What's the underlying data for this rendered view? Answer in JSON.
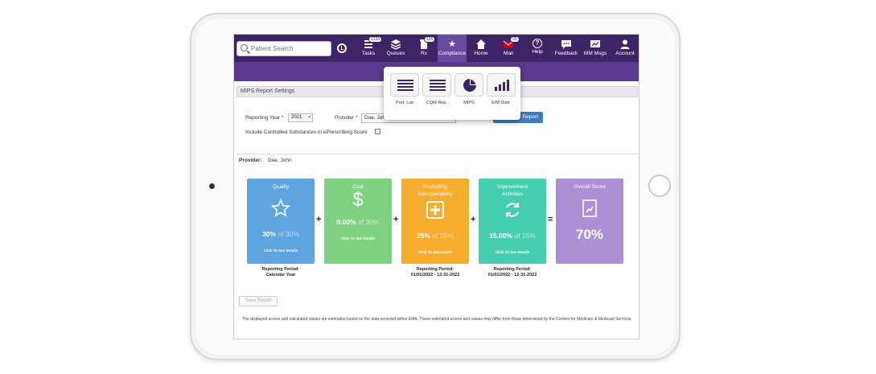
{
  "search": {
    "placeholder": "Patient Search"
  },
  "nav": [
    {
      "id": "tasks",
      "label": "Tasks",
      "icon": "tasks-icon",
      "badge": "1235"
    },
    {
      "id": "queues",
      "label": "Queues",
      "icon": "queues-icon"
    },
    {
      "id": "rx",
      "label": "Rx",
      "icon": "rx-icon",
      "badge": "135"
    },
    {
      "id": "compliance",
      "label": "Compliance",
      "icon": "star-icon"
    },
    {
      "id": "home",
      "label": "Home",
      "icon": "home-icon"
    },
    {
      "id": "mail",
      "label": "Mail",
      "icon": "mail-icon",
      "badge": "35"
    },
    {
      "id": "help",
      "label": "Help",
      "icon": "help-icon"
    },
    {
      "id": "feedback",
      "label": "Feedback",
      "icon": "feedback-icon"
    },
    {
      "id": "mm-msgs",
      "label": "MM Msgs",
      "icon": "messages-icon"
    },
    {
      "id": "account",
      "label": "Account",
      "icon": "account-icon"
    }
  ],
  "dropdown": {
    "items": [
      {
        "label": "Port. List",
        "icon": "list-icon"
      },
      {
        "label": "CQM Rep.",
        "icon": "list-icon"
      },
      {
        "label": "MIPS",
        "icon": "pie-chart-icon"
      },
      {
        "label": "E/M Distr.",
        "icon": "bar-chart-icon"
      }
    ]
  },
  "settings": {
    "title": "MIPS Report Settings",
    "reporting_year_label": "Reporting Year",
    "reporting_year_value": "2021",
    "provider_label": "Provider",
    "provider_value": "Doe, John",
    "run_button": "Report",
    "controlled_substances_label": "Include Controlled Substances in ePrescribing Score"
  },
  "report": {
    "provider_label": "Provider:",
    "provider_value": "Doe, John",
    "cards": [
      {
        "title": "Quality",
        "score": "30%",
        "of": " of 30%",
        "details": "Click To See Details",
        "color": "#5ea6e0",
        "icon": "star-icon"
      },
      {
        "title": "Cost",
        "score": "0.00%",
        "of": " of 30%",
        "details": "Click To See Details",
        "color": "#7fd380",
        "icon": "dollar-icon"
      },
      {
        "title": "Promoting Interoperability",
        "score": "25%",
        "of": " of 25%",
        "details": "Click To See Details",
        "color": "#f6ad2c",
        "icon": "plus-box-icon"
      },
      {
        "title": "Improvement Activities",
        "score": "15.00%",
        "of": " of 15%",
        "details": "Click To See Details",
        "color": "#45cfae",
        "icon": "refresh-icon"
      },
      {
        "title": "Overall Score",
        "score": "70%",
        "color": "#ad8fd6",
        "icon": "report-icon"
      }
    ],
    "operators": [
      "+",
      "+",
      "+",
      "="
    ],
    "periods": [
      {
        "label": "Reporting Period:",
        "value": "Calendar Year"
      },
      {
        "label": "",
        "value": ""
      },
      {
        "label": "Reporting Period:",
        "value": "01/01/2022 - 12-31-2022"
      },
      {
        "label": "Reporting Period:",
        "value": "01/01/2022 - 12-31-2022"
      }
    ],
    "save_button": "Save Report",
    "disclaimer": "The displayed scores and calculated values are estimated based on the data recorded within EMA. These estimated scores and values may differ from those determined by the Centers for Medicare & Medicaid Services."
  },
  "colors": {
    "nav_bg": "#3d2466",
    "banner": "#5b3a8f",
    "run_button": "#3b7dc4"
  }
}
